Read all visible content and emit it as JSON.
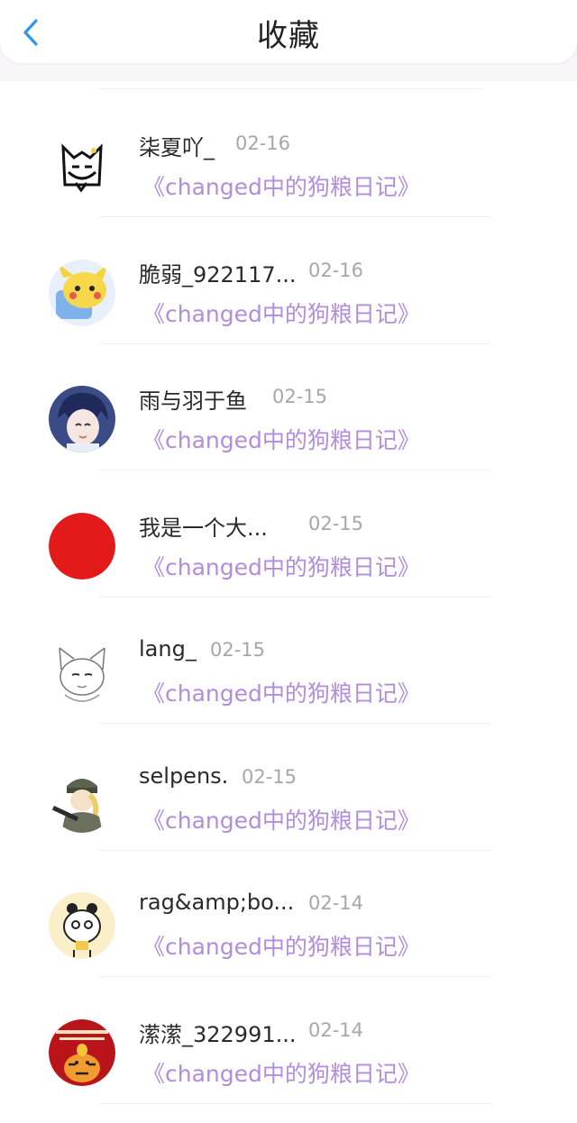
{
  "header": {
    "title": "收藏",
    "back_icon": "chevron-left-icon",
    "back_color": "#2f95e8"
  },
  "favorites": [
    {
      "user": "柒夏吖_",
      "date": "02-16",
      "book": "《changed中的狗粮日记》"
    },
    {
      "user": "脆弱_922117...",
      "date": "02-16",
      "book": "《changed中的狗粮日记》"
    },
    {
      "user": "雨与羽于鱼",
      "date": "02-15",
      "book": "《changed中的狗粮日记》"
    },
    {
      "user": "我是一个大...",
      "date": "02-15",
      "book": "《changed中的狗粮日记》"
    },
    {
      "user": "lang_",
      "date": "02-15",
      "book": "《changed中的狗粮日记》"
    },
    {
      "user": "selpens.",
      "date": "02-15",
      "book": "《changed中的狗粮日记》"
    },
    {
      "user": "rag&amp;bo...",
      "date": "02-14",
      "book": "《changed中的狗粮日记》"
    },
    {
      "user": "潆潆_322991...",
      "date": "02-14",
      "book": "《changed中的狗粮日记》"
    }
  ],
  "colors": {
    "book_link": "#b18ddc",
    "date": "#a7a7a7",
    "avatar_red": "#e31a1a"
  }
}
